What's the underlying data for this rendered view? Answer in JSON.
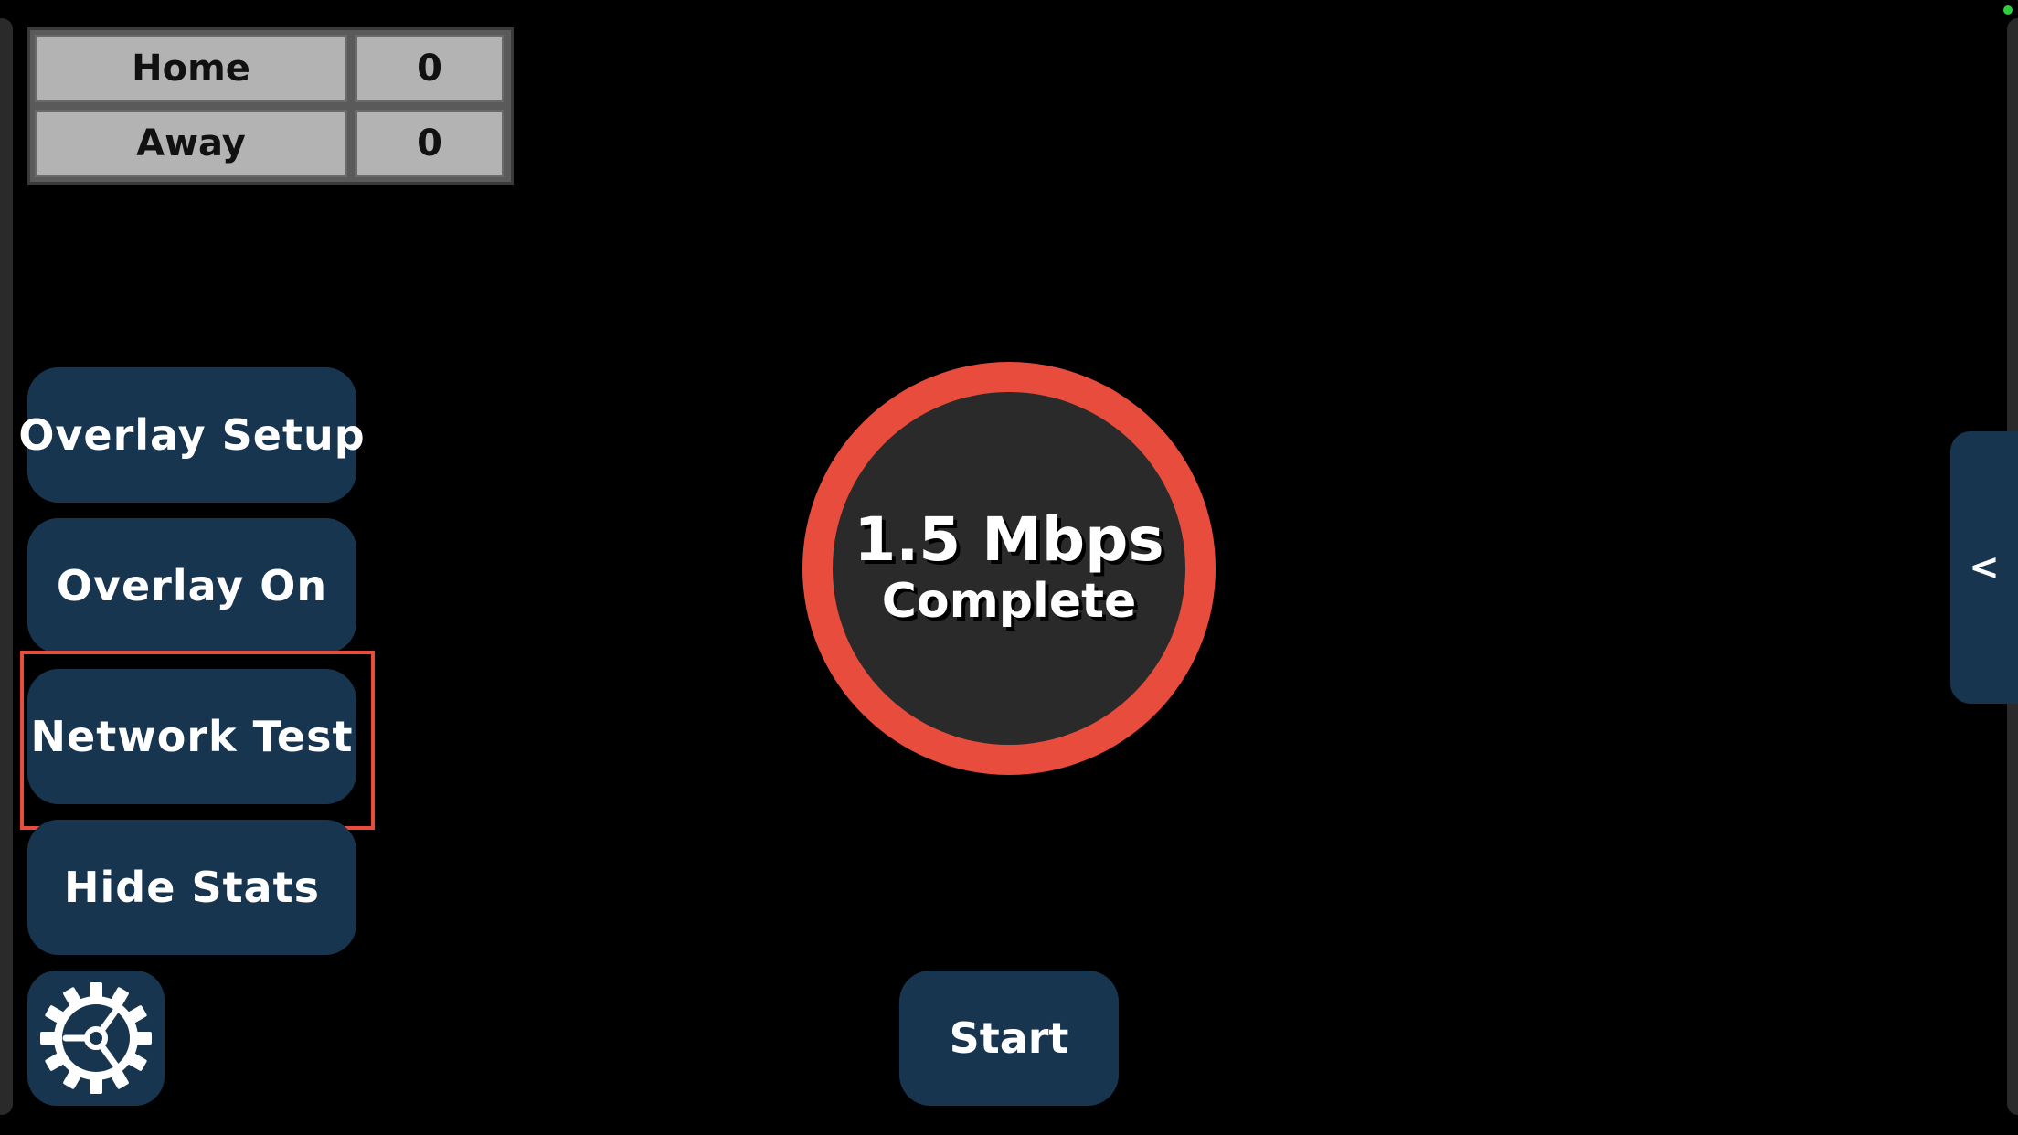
{
  "scoreboard": {
    "rows": [
      {
        "team": "Home",
        "score": "0"
      },
      {
        "team": "Away",
        "score": "0"
      }
    ]
  },
  "menu": {
    "overlay_setup": "Overlay Setup",
    "overlay_on": "Overlay On",
    "network_test": "Network Test",
    "hide_stats": "Hide Stats",
    "settings_icon": "gear-icon"
  },
  "speed_test": {
    "value": "1.5 Mbps",
    "status": "Complete",
    "ring_color": "#e74c3c"
  },
  "start_label": "Start",
  "drawer_label": "<",
  "colors": {
    "button_bg": "#183550",
    "highlight": "#e74c3c",
    "background": "#000000"
  }
}
